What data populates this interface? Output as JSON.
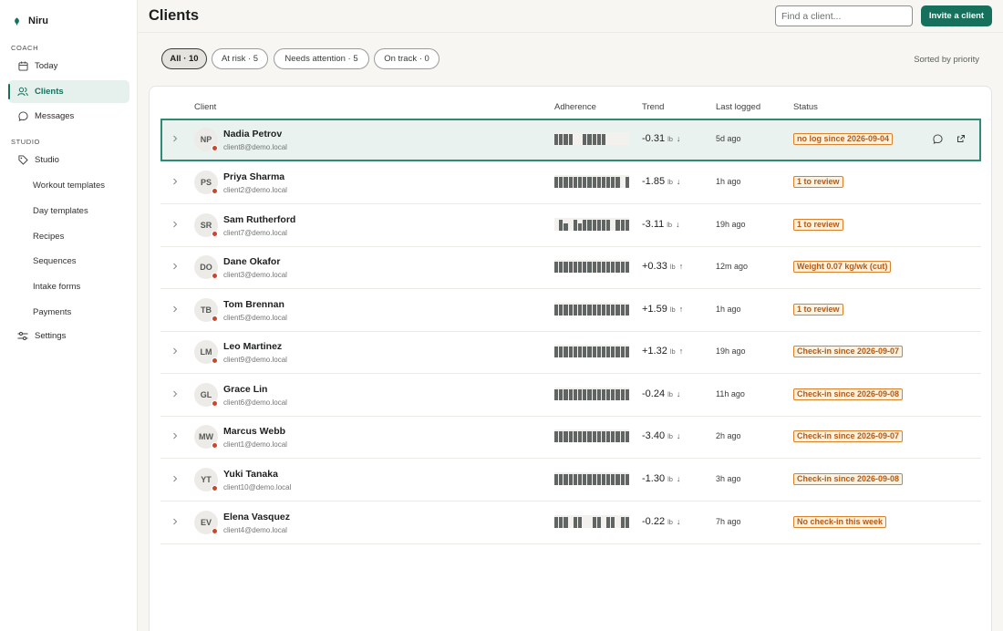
{
  "app": {
    "name": "Niru"
  },
  "sidebar": {
    "coach_label": "COACH",
    "studio_label": "STUDIO",
    "nav": [
      {
        "label": "Today",
        "icon": "calendar-icon"
      },
      {
        "label": "Clients",
        "icon": "users-icon",
        "active": true
      },
      {
        "label": "Messages",
        "icon": "chat-icon"
      },
      {
        "label": "Studio",
        "icon": "tag-icon"
      },
      {
        "label": "Settings",
        "icon": "sliders-icon"
      }
    ],
    "studio_items": [
      "Workout templates",
      "Day templates",
      "Recipes",
      "Sequences",
      "Intake forms",
      "Payments"
    ]
  },
  "header": {
    "title": "Clients",
    "search_placeholder": "Find a client...",
    "invite_label": "Invite a client"
  },
  "filters": {
    "chips": [
      "All · 10",
      "At risk · 5",
      "Needs attention · 5",
      "On track · 0"
    ],
    "active_index": 0,
    "sort_text": "Sorted by priority"
  },
  "table": {
    "columns": [
      "Client",
      "Adherence",
      "Trend",
      "Last logged",
      "Status"
    ],
    "rows": [
      {
        "initials": "NP",
        "name": "Nadia Petrov",
        "email": "client8@demo.local",
        "adherence": [
          1,
          1,
          1,
          1,
          0,
          0,
          1,
          1,
          1,
          1,
          1,
          0,
          0,
          0,
          0,
          0
        ],
        "trend": "-0.31",
        "unit": "lb",
        "arrow": "↓",
        "logged": "5d ago",
        "status": "no log since 2026-09-04",
        "dot": "#c9472e",
        "selected": true
      },
      {
        "initials": "PS",
        "name": "Priya Sharma",
        "email": "client2@demo.local",
        "adherence": [
          1,
          1,
          1,
          1,
          1,
          1,
          1,
          1,
          1,
          1,
          1,
          1,
          1,
          1,
          0,
          1
        ],
        "trend": "-1.85",
        "unit": "lb",
        "arrow": "↓",
        "logged": "1h ago",
        "status": "1 to review",
        "dot": "#c9472e"
      },
      {
        "initials": "SR",
        "name": "Sam Rutherford",
        "email": "client7@demo.local",
        "adherence": [
          0,
          1,
          0.7,
          0,
          1,
          0.7,
          1,
          1,
          1,
          1,
          1,
          1,
          0,
          1,
          1,
          1
        ],
        "trend": "-3.11",
        "unit": "lb",
        "arrow": "↓",
        "logged": "19h ago",
        "status": "1 to review",
        "dot": "#c9472e"
      },
      {
        "initials": "DO",
        "name": "Dane Okafor",
        "email": "client3@demo.local",
        "adherence": [
          1,
          1,
          1,
          1,
          1,
          1,
          1,
          1,
          1,
          1,
          1,
          1,
          1,
          1,
          1,
          1
        ],
        "trend": "+0.33",
        "unit": "lb",
        "arrow": "↑",
        "logged": "12m ago",
        "status": "Weight 0.07 kg/wk (cut)",
        "dot": "#c9472e"
      },
      {
        "initials": "TB",
        "name": "Tom Brennan",
        "email": "client5@demo.local",
        "adherence": [
          1,
          1,
          1,
          1,
          1,
          1,
          1,
          1,
          1,
          1,
          1,
          1,
          1,
          1,
          1,
          1
        ],
        "trend": "+1.59",
        "unit": "lb",
        "arrow": "↑",
        "logged": "1h ago",
        "status": "1 to review",
        "dot": "#c9472e"
      },
      {
        "initials": "LM",
        "name": "Leo Martinez",
        "email": "client9@demo.local",
        "adherence": [
          1,
          1,
          1,
          1,
          1,
          1,
          1,
          1,
          1,
          1,
          1,
          1,
          1,
          1,
          1,
          1
        ],
        "trend": "+1.32",
        "unit": "lb",
        "arrow": "↑",
        "logged": "19h ago",
        "status": "Check-in since 2026-09-07",
        "dot": "#c9472e"
      },
      {
        "initials": "GL",
        "name": "Grace Lin",
        "email": "client6@demo.local",
        "adherence": [
          1,
          1,
          1,
          1,
          1,
          1,
          1,
          1,
          1,
          1,
          1,
          1,
          1,
          1,
          1,
          1
        ],
        "trend": "-0.24",
        "unit": "lb",
        "arrow": "↓",
        "logged": "11h ago",
        "status": "Check-in since 2026-09-08",
        "dot": "#c9472e"
      },
      {
        "initials": "MW",
        "name": "Marcus Webb",
        "email": "client1@demo.local",
        "adherence": [
          1,
          1,
          1,
          1,
          1,
          1,
          1,
          1,
          1,
          1,
          1,
          1,
          1,
          1,
          1,
          1
        ],
        "trend": "-3.40",
        "unit": "lb",
        "arrow": "↓",
        "logged": "2h ago",
        "status": "Check-in since 2026-09-07",
        "dot": "#c9472e"
      },
      {
        "initials": "YT",
        "name": "Yuki Tanaka",
        "email": "client10@demo.local",
        "adherence": [
          1,
          1,
          1,
          1,
          1,
          1,
          1,
          1,
          1,
          1,
          1,
          1,
          1,
          1,
          1,
          1
        ],
        "trend": "-1.30",
        "unit": "lb",
        "arrow": "↓",
        "logged": "3h ago",
        "status": "Check-in since 2026-09-08",
        "dot": "#c9472e"
      },
      {
        "initials": "EV",
        "name": "Elena Vasquez",
        "email": "client4@demo.local",
        "adherence": [
          1,
          1,
          1,
          0,
          1,
          1,
          0,
          0,
          1,
          1,
          0,
          1,
          1,
          0,
          1,
          1
        ],
        "trend": "-0.22",
        "unit": "lb",
        "arrow": "↓",
        "logged": "7h ago",
        "status": "No check-in this week",
        "dot": "#c9472e"
      }
    ]
  }
}
